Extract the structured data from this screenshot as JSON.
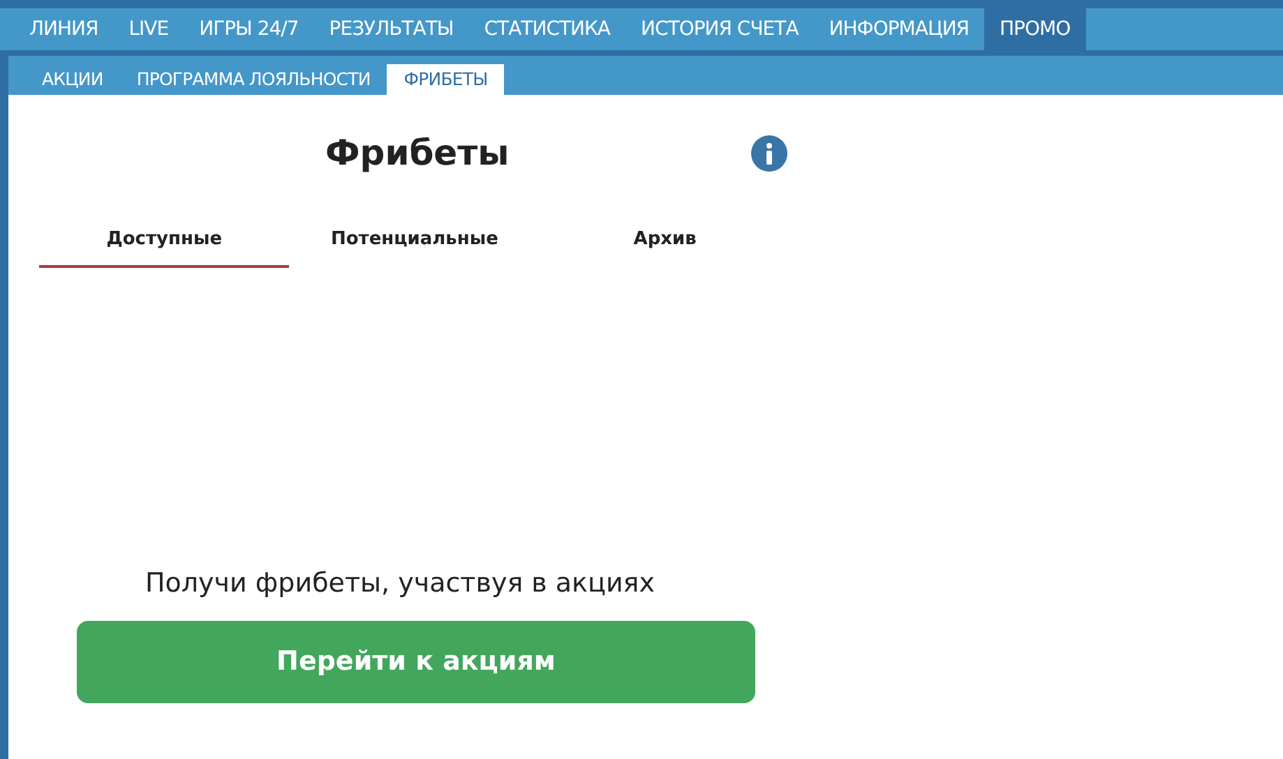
{
  "main_nav": [
    {
      "label": "ЛИНИЯ",
      "selected": false
    },
    {
      "label": "LIVE",
      "selected": false
    },
    {
      "label": "ИГРЫ 24/7",
      "selected": false
    },
    {
      "label": "РЕЗУЛЬТАТЫ",
      "selected": false
    },
    {
      "label": "СТАТИСТИКА",
      "selected": false
    },
    {
      "label": "ИСТОРИЯ СЧЕТА",
      "selected": false
    },
    {
      "label": "ИНФОРМАЦИЯ",
      "selected": false
    },
    {
      "label": "ПРОМО",
      "selected": true
    }
  ],
  "sub_nav": [
    {
      "label": "АКЦИИ",
      "selected": false
    },
    {
      "label": "ПРОГРАММА ЛОЯЛЬНОСТИ",
      "selected": false
    },
    {
      "label": "ФРИБЕТЫ",
      "selected": true
    }
  ],
  "title": "Фрибеты",
  "tabs": [
    {
      "label": "Доступные",
      "selected": true
    },
    {
      "label": "Потенциальные",
      "selected": false
    },
    {
      "label": "Архив",
      "selected": false
    }
  ],
  "empty_message": "Получи фрибеты, участвуя в акциях",
  "action_button": "Перейти к акциям"
}
